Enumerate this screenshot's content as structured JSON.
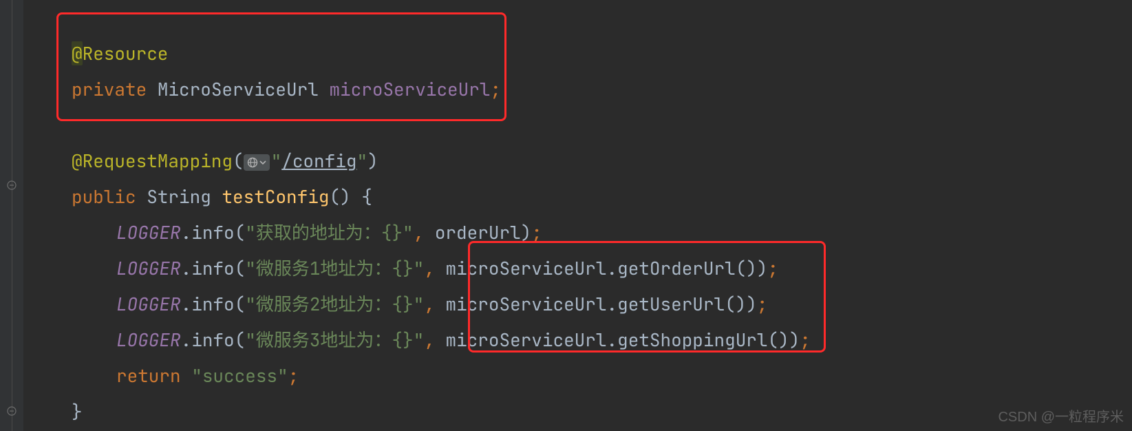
{
  "code": {
    "l1": {
      "annotation": "@Resource",
      "at": "@",
      "rest": "Resource"
    },
    "l2": {
      "kw": "private",
      "type": "MicroServiceUrl",
      "ident": "microServiceUrl",
      "semi": ";"
    },
    "l3": {
      "annotation": "@RequestMapping",
      "lp": "(",
      "str_open": "\"",
      "url": "/config",
      "str_close": "\"",
      "rp": ")"
    },
    "l4": {
      "kw": "public",
      "type": "String",
      "method": "testConfig",
      "parens": "()",
      "brace": " {"
    },
    "l5": {
      "logger": "LOGGER",
      "dot": ".",
      "call": "info",
      "lp": "(",
      "str": "\"获取的地址为：{}\"",
      "comma": ",",
      "sp": " ",
      "arg": "orderUrl",
      "rp": ")",
      "semi": ";"
    },
    "l6": {
      "logger": "LOGGER",
      "dot": ".",
      "call": "info",
      "lp": "(",
      "str": "\"微服务1地址为：{}\"",
      "comma": ",",
      "sp": " ",
      "obj": "microServiceUrl",
      "dot2": ".",
      "m": "getOrderUrl",
      "parens": "()",
      "rp": ")",
      "semi": ";"
    },
    "l7": {
      "logger": "LOGGER",
      "dot": ".",
      "call": "info",
      "lp": "(",
      "str": "\"微服务2地址为：{}\"",
      "comma": ",",
      "sp": " ",
      "obj": "microServiceUrl",
      "dot2": ".",
      "m": "getUserUrl",
      "parens": "()",
      "rp": ")",
      "semi": ";"
    },
    "l8": {
      "logger": "LOGGER",
      "dot": ".",
      "call": "info",
      "lp": "(",
      "str": "\"微服务3地址为：{}\"",
      "comma": ",",
      "sp": " ",
      "obj": "microServiceUrl",
      "dot2": ".",
      "m": "getShoppingUrl",
      "parens": "()",
      "rp": ")",
      "semi": ";"
    },
    "l9": {
      "kw": "return",
      "sp": " ",
      "str": "\"success\"",
      "semi": ";"
    },
    "l10": {
      "brace": "}"
    }
  },
  "watermark": "CSDN @一粒程序米"
}
